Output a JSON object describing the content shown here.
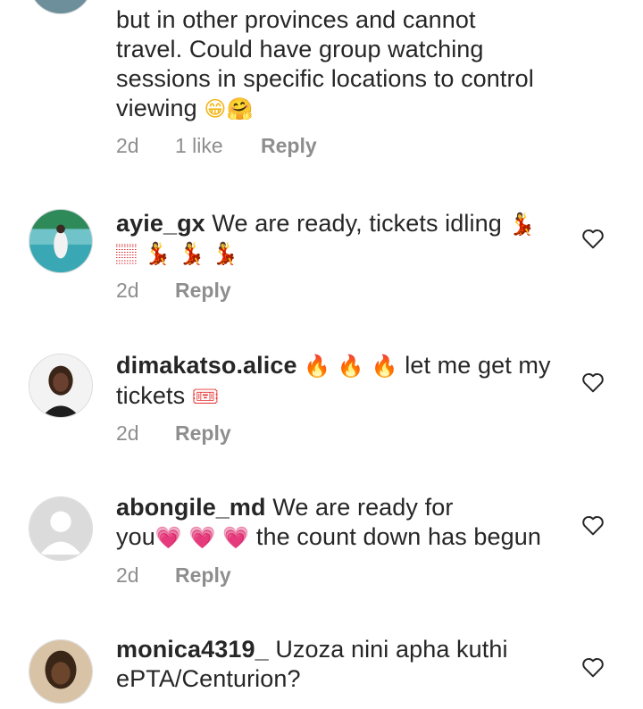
{
  "comments": [
    {
      "username": "",
      "text_lines": [
        "but in other provinces and cannot",
        "travel. Could have group watching",
        "sessions in specific locations to control",
        "viewing"
      ],
      "emojis": [
        "😁",
        "🤗"
      ],
      "time": "2d",
      "likes": "1 like",
      "reply": "Reply"
    },
    {
      "username": "ayie_gx",
      "text": "We are ready, tickets idling",
      "emojis_line1": "💃",
      "emojis_line2": "🏽 💃 💃 💃",
      "time": "2d",
      "reply": "Reply"
    },
    {
      "username": "dimakatso.alice",
      "emojis_inline": "🔥 🔥 🔥",
      "text": "let me get my",
      "text2": "tickets",
      "emoji_end": "🎟",
      "time": "2d",
      "reply": "Reply"
    },
    {
      "username": "abongile_md",
      "text": "We are ready for",
      "text2": "you",
      "emojis_hearts": "💗 💗 💗",
      "text3": "the count down has begun",
      "time": "2d",
      "reply": "Reply"
    },
    {
      "username": "monica4319_",
      "text": "Uzoza nini apha kuthi",
      "text2": "ePTA/Centurion?"
    }
  ],
  "icons": {
    "like": "heart-outline-icon",
    "avatar_default": "default-avatar-icon"
  },
  "colors": {
    "text": "#262626",
    "meta": "#8e8e8e",
    "heart_emoji": "#e8528a"
  }
}
